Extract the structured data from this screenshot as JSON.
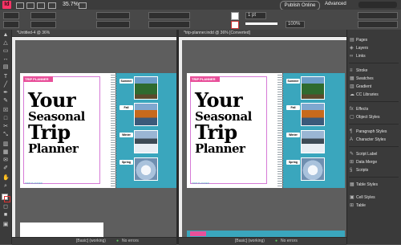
{
  "app": {
    "logo": "Id",
    "zoom": "35.7%",
    "publish": "Publish Online",
    "workspace": "Advanced"
  },
  "control": {
    "pt_value": "1 pt",
    "percent": "100%"
  },
  "doc_left": {
    "tab": "*Untitled-4 @ 36%",
    "status_view": "[Basic] (working)",
    "status_errors": "No errors"
  },
  "doc_right": {
    "tab": "*trip-planner.indd @ 36% [Converted]",
    "status_view": "[Basic] (working)",
    "status_errors": "No errors"
  },
  "spread": {
    "tag": "TRIP PLANNER",
    "title_lines": [
      "Your",
      "Seasonal",
      "Trip",
      "Planner"
    ],
    "footer": "TRIP PLANNER",
    "seasons": [
      "Summer",
      "Fall",
      "Winter",
      "Spring"
    ]
  },
  "panels": [
    {
      "label": "Pages",
      "icon": "pages-icon"
    },
    {
      "label": "Layers",
      "icon": "layers-icon"
    },
    {
      "label": "Links",
      "icon": "links-icon"
    },
    {
      "label": "Stroke",
      "icon": "stroke-icon"
    },
    {
      "label": "Swatches",
      "icon": "swatches-icon"
    },
    {
      "label": "Gradient",
      "icon": "gradient-icon"
    },
    {
      "label": "CC Libraries",
      "icon": "cc-libraries-icon"
    },
    {
      "label": "Effects",
      "icon": "effects-icon"
    },
    {
      "label": "Object Styles",
      "icon": "object-styles-icon"
    },
    {
      "label": "Paragraph Styles",
      "icon": "paragraph-styles-icon"
    },
    {
      "label": "Character Styles",
      "icon": "character-styles-icon"
    },
    {
      "label": "Script Label",
      "icon": "script-label-icon"
    },
    {
      "label": "Data Merge",
      "icon": "data-merge-icon"
    },
    {
      "label": "Scripts",
      "icon": "scripts-icon"
    },
    {
      "label": "Table Styles",
      "icon": "table-styles-icon"
    },
    {
      "label": "Cell Styles",
      "icon": "cell-styles-icon"
    },
    {
      "label": "Table",
      "icon": "table-icon"
    }
  ],
  "colors": {
    "accent_pink": "#e8509a",
    "teal": "#3aa6bd",
    "logo_pink": "#ff3366"
  }
}
